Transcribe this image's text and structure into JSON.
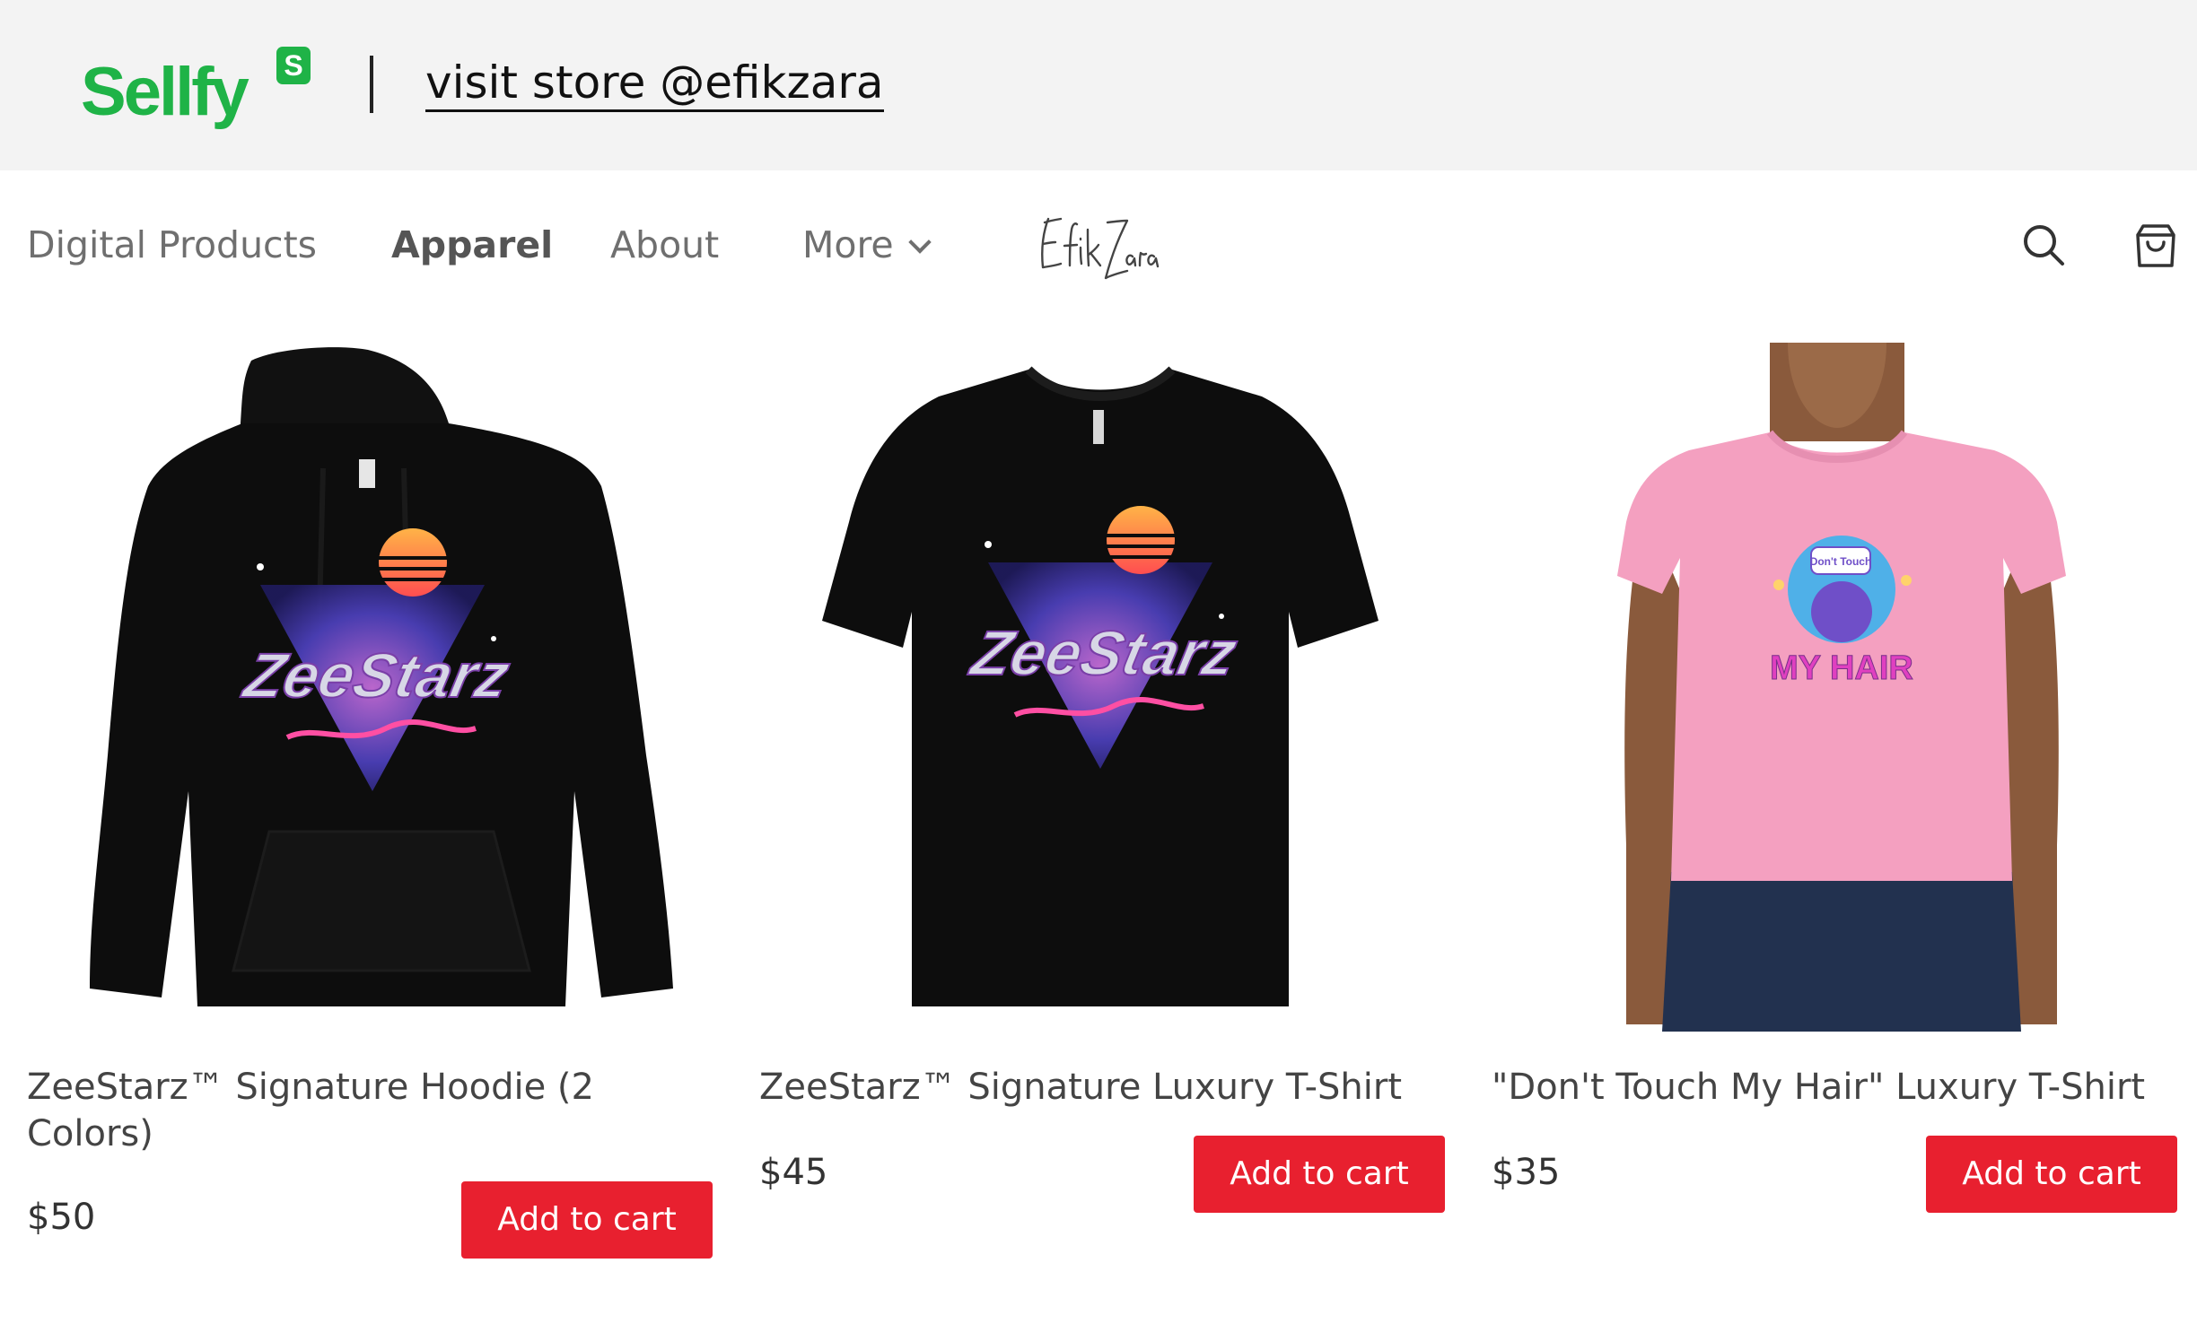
{
  "header": {
    "brand": "Sellfy",
    "brand_badge": "S",
    "visit_link": "visit store @efikzara",
    "brand_color": "#1fb347"
  },
  "nav": {
    "items": [
      {
        "label": "Digital Products",
        "active": false
      },
      {
        "label": "Apparel",
        "active": true
      },
      {
        "label": "About",
        "active": false
      },
      {
        "label": "More",
        "active": false
      }
    ],
    "store_logo_text": "EfikZara",
    "icons": [
      "search-icon",
      "shopping-bag-icon"
    ]
  },
  "products": [
    {
      "name": "ZeeStarz™ Signature Hoodie (2 Colors)",
      "price": "$50",
      "button": "Add to cart",
      "image": "black-hoodie-with-retro-zeestarz-graphic"
    },
    {
      "name": "ZeeStarz™ Signature Luxury T-Shirt",
      "price": "$45",
      "button": "Add to cart",
      "image": "black-tshirt-with-retro-zeestarz-graphic"
    },
    {
      "name": "\"Don't Touch My Hair\" Luxury T-Shirt",
      "price": "$35",
      "button": "Add to cart",
      "image": "model-in-pink-tshirt-dont-touch-my-hair-graphic"
    }
  ],
  "colors": {
    "button": "#e8202f",
    "topbar_bg": "#f3f3f3"
  }
}
